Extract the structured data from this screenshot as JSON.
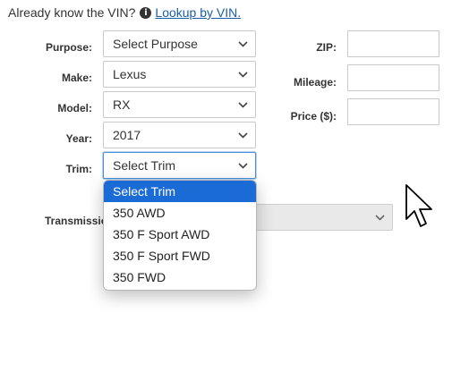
{
  "vin": {
    "prompt": "Already know the VIN?",
    "info_glyph": "i",
    "link_label": "Lookup by VIN."
  },
  "form": {
    "purpose": {
      "label": "Purpose:",
      "value": "Select Purpose"
    },
    "make": {
      "label": "Make:",
      "value": "Lexus"
    },
    "model": {
      "label": "Model:",
      "value": "RX"
    },
    "year": {
      "label": "Year:",
      "value": "2017"
    },
    "trim": {
      "label": "Trim:",
      "value": "Select Trim"
    },
    "transmission": {
      "label": "Transmission",
      "value": ""
    },
    "zip": {
      "label": "ZIP:",
      "value": ""
    },
    "mileage": {
      "label": "Mileage:",
      "value": ""
    },
    "price": {
      "label": "Price ($):",
      "value": ""
    }
  },
  "trim_dropdown": {
    "options": [
      "Select Trim",
      "350 AWD",
      "350 F Sport AWD",
      "350 F Sport FWD",
      "350 FWD"
    ],
    "selected_index": 0,
    "highlight_color": "#1a6bd6"
  },
  "colors": {
    "link": "#1a5ea8",
    "focus_border": "#4a90d9",
    "disabled_bg": "#e9e9e9"
  },
  "icons": {
    "info": "info-circle-icon",
    "chevron": "chevron-down-icon",
    "cursor": "mouse-pointer-icon"
  }
}
